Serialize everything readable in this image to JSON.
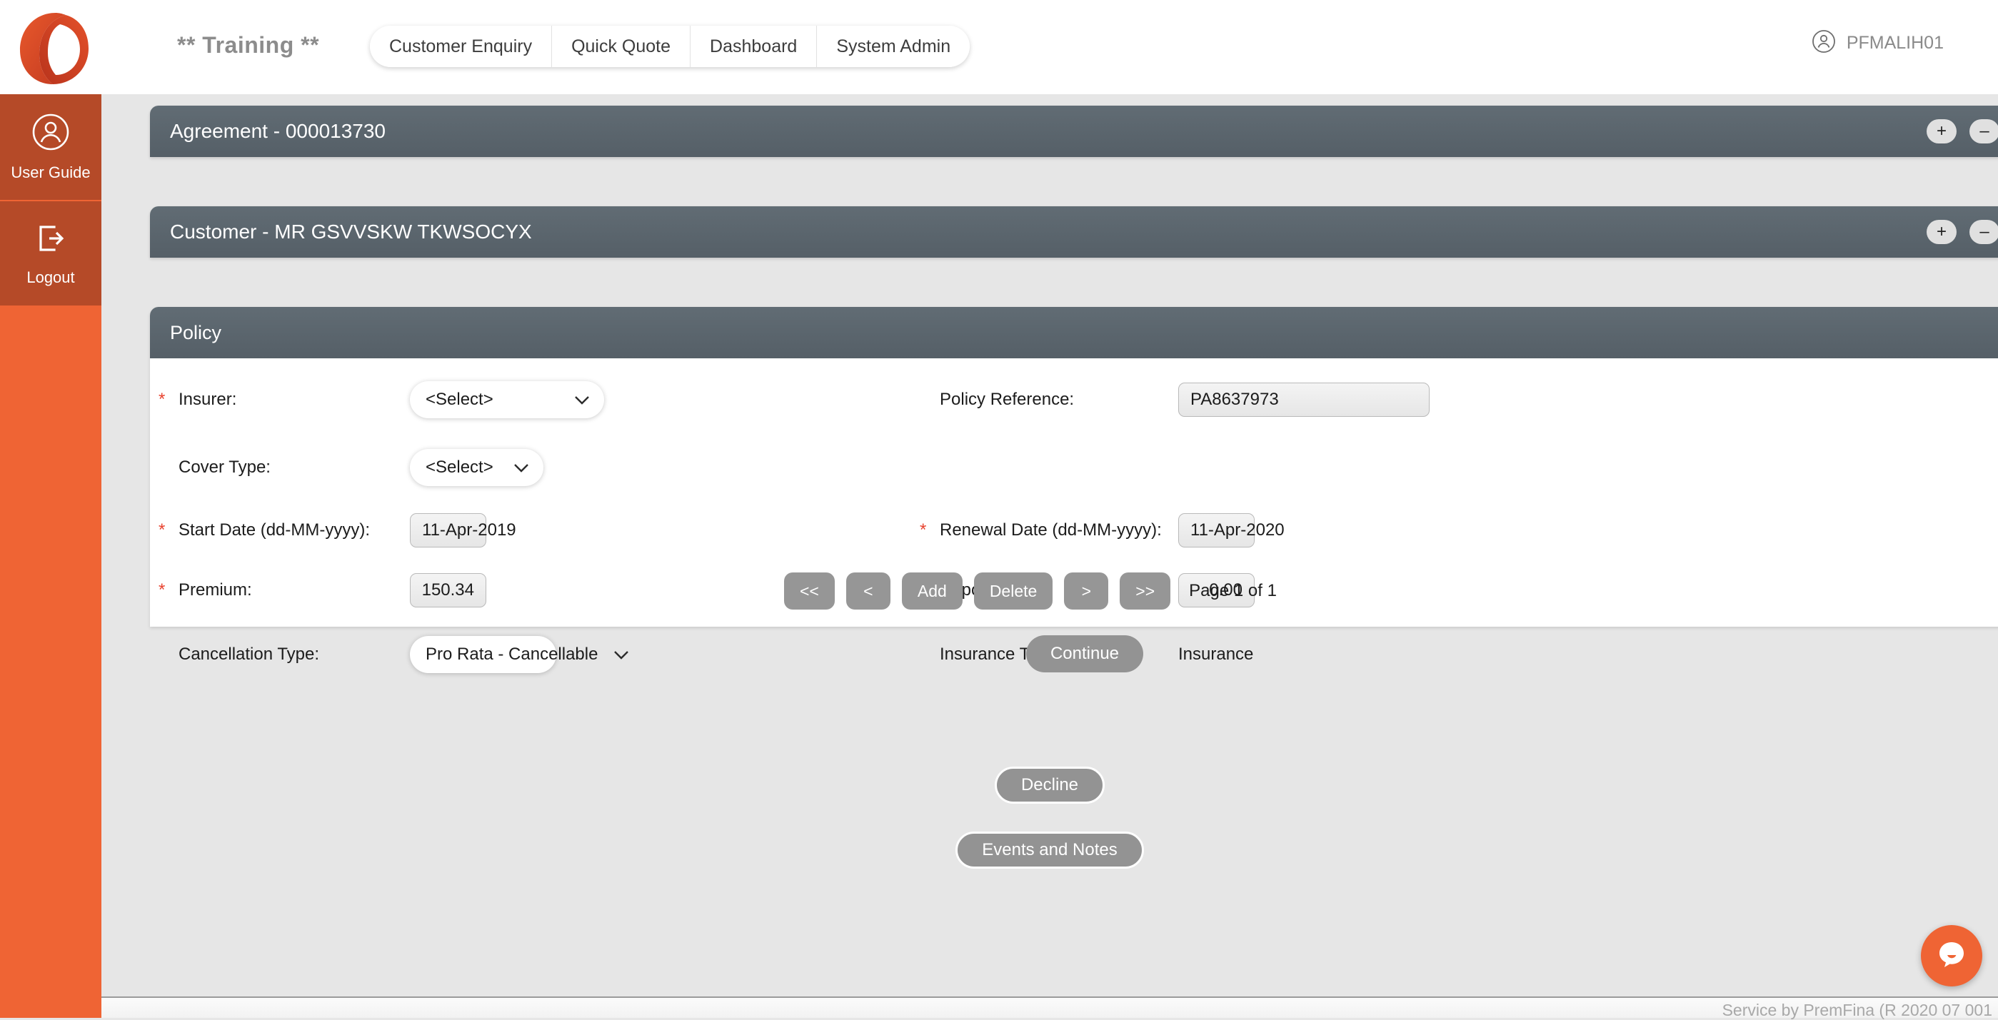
{
  "header": {
    "logo_icon": "premfina-logo-icon",
    "training_label": "** Training **",
    "tabs": [
      {
        "label": "Customer Enquiry"
      },
      {
        "label": "Quick Quote"
      },
      {
        "label": "Dashboard"
      },
      {
        "label": "System Admin"
      }
    ],
    "user_icon": "user-circle-icon",
    "user_name": "PFMALIH01"
  },
  "sidebar": {
    "items": [
      {
        "label": "User Guide",
        "icon": "user-circle-icon"
      },
      {
        "label": "Logout",
        "icon": "logout-arrow-icon"
      }
    ]
  },
  "panels": {
    "agreement": {
      "title": "Agreement - 000013730",
      "expand": "+",
      "collapse": "–"
    },
    "customer": {
      "title": "Customer - MR GSVVSKW TKWSOCYX",
      "expand": "+",
      "collapse": "–"
    },
    "policy": {
      "title": "Policy"
    }
  },
  "form": {
    "insurer": {
      "label": "Insurer:",
      "required": "*",
      "value": "<Select>",
      "chevron": "⌄"
    },
    "cover_type": {
      "label": "Cover Type:",
      "value": "<Select>",
      "chevron": "⌄"
    },
    "start_date": {
      "label": "Start Date (dd-MM-yyyy):",
      "required": "*",
      "value": "11-Apr-2019"
    },
    "premium": {
      "label": "Premium:",
      "required": "*",
      "value": "150.34"
    },
    "cancellation_type": {
      "label": "Cancellation Type:",
      "value": "Pro Rata - Cancellable",
      "chevron": "⌄"
    },
    "policy_reference": {
      "label": "Policy Reference:",
      "value": "PA8637973"
    },
    "renewal_date": {
      "label": "Renewal Date (dd-MM-yyyy):",
      "required": "*",
      "value": "11-Apr-2020"
    },
    "deposit": {
      "label": "Deposit:",
      "value": "0.00"
    },
    "insurance_type": {
      "label": "Insurance Type:",
      "value": "Insurance"
    }
  },
  "pager": {
    "first": "<<",
    "prev": "<",
    "add": "Add",
    "delete": "Delete",
    "next": ">",
    "last": ">>",
    "page_info": "Page 1 of 1"
  },
  "actions": {
    "continue": "Continue",
    "decline": "Decline",
    "events_and_notes": "Events and Notes"
  },
  "footer": {
    "text": "Service by PremFina (R 2020 07 001"
  },
  "chat": {
    "icon": "chat-bubble-icon"
  },
  "colors": {
    "brand_orange": "#ef6434",
    "sidebar_item": "#b54a28",
    "panel_header": "#5a646c",
    "required_asterisk": "#e8432f",
    "button_gray": "#939393",
    "page_background": "#e6e6e6"
  }
}
